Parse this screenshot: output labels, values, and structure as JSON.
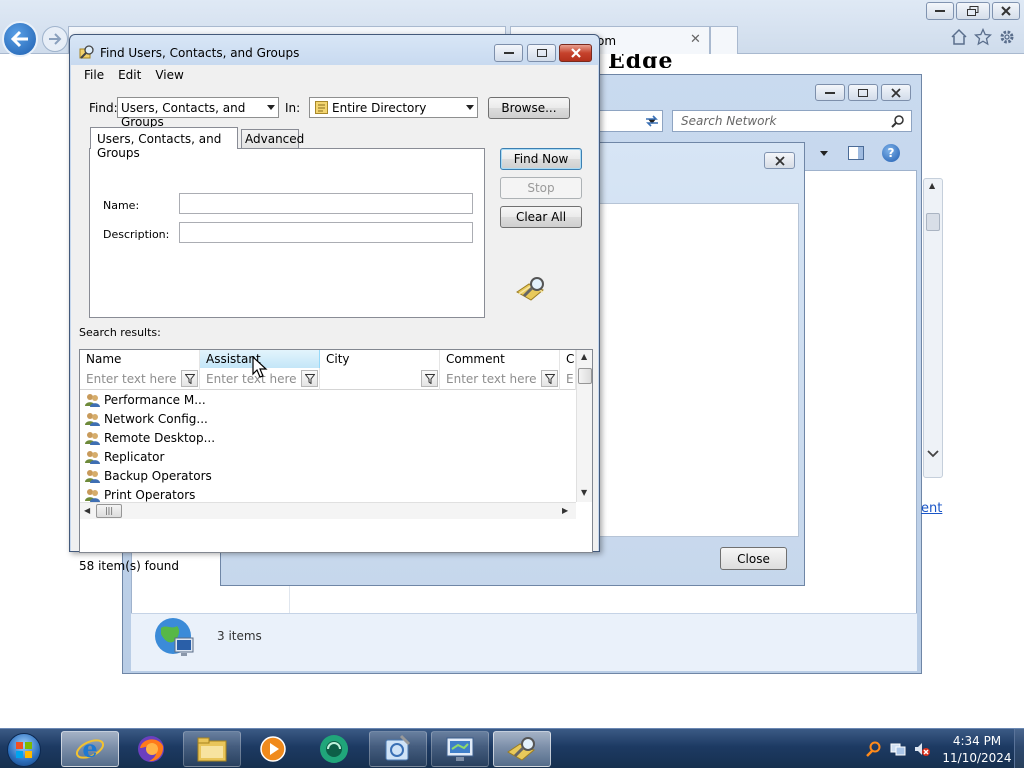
{
  "browser": {
    "tab_partial_text": "om",
    "heading_partial": "Edge",
    "search_placeholder": "Search Network",
    "link_partial": "ent"
  },
  "network_window": {
    "status_count": "3 items"
  },
  "middle_dialog": {
    "close_label": "Close"
  },
  "find_dialog": {
    "title": "Find Users, Contacts, and Groups",
    "menu": [
      "File",
      "Edit",
      "View"
    ],
    "find_label": "Find:",
    "find_value": "Users, Contacts, and Groups",
    "in_label": "In:",
    "in_value": "Entire Directory",
    "browse_label": "Browse...",
    "tabs": [
      "Users, Contacts, and Groups",
      "Advanced"
    ],
    "name_label": "Name:",
    "description_label": "Description:",
    "find_now_label": "Find Now",
    "stop_label": "Stop",
    "clear_all_label": "Clear All",
    "results_label": "Search results:",
    "columns": [
      "Name",
      "Assistant",
      "City",
      "Comment",
      "C"
    ],
    "filter_placeholder": "Enter text here",
    "filter_partial": "E",
    "rows": [
      "Performance M...",
      "Network Config...",
      "Remote Desktop...",
      "Replicator",
      "Backup Operators",
      "Print Operators"
    ],
    "status": "58 item(s) found"
  },
  "taskbar": {
    "time": "4:34 PM",
    "date": "11/10/2024"
  },
  "colors": {
    "accent": "#3c7fb1",
    "titlebar": "#c3d6ee",
    "taskbar": "#1d3a63",
    "close_red": "#c6422c"
  }
}
